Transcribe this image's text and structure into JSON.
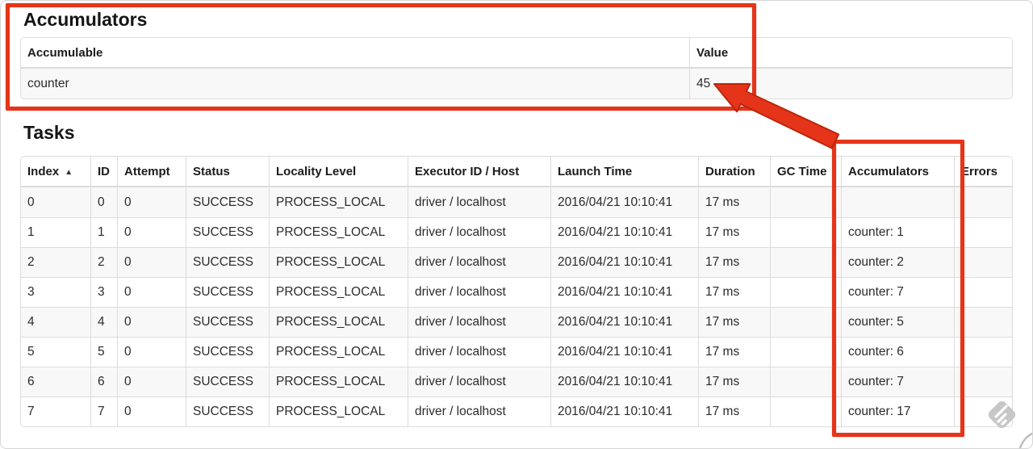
{
  "accumulators_section": {
    "title": "Accumulators",
    "table": {
      "header": {
        "accumulable": "Accumulable",
        "value": "Value"
      },
      "row": {
        "accumulable": "counter",
        "value": "45"
      }
    }
  },
  "tasks_section": {
    "title": "Tasks",
    "columns": {
      "index": "Index",
      "id": "ID",
      "attempt": "Attempt",
      "status": "Status",
      "locality": "Locality Level",
      "executor": "Executor ID / Host",
      "launch": "Launch Time",
      "duration": "Duration",
      "gc": "GC Time",
      "accumulators": "Accumulators",
      "errors": "Errors"
    },
    "sort_indicator": "▲",
    "rows": [
      {
        "index": "0",
        "id": "0",
        "attempt": "0",
        "status": "SUCCESS",
        "locality": "PROCESS_LOCAL",
        "executor": "driver / localhost",
        "launch": "2016/04/21 10:10:41",
        "duration": "17 ms",
        "gc": "",
        "accumulators": "",
        "errors": ""
      },
      {
        "index": "1",
        "id": "1",
        "attempt": "0",
        "status": "SUCCESS",
        "locality": "PROCESS_LOCAL",
        "executor": "driver / localhost",
        "launch": "2016/04/21 10:10:41",
        "duration": "17 ms",
        "gc": "",
        "accumulators": "counter: 1",
        "errors": ""
      },
      {
        "index": "2",
        "id": "2",
        "attempt": "0",
        "status": "SUCCESS",
        "locality": "PROCESS_LOCAL",
        "executor": "driver / localhost",
        "launch": "2016/04/21 10:10:41",
        "duration": "17 ms",
        "gc": "",
        "accumulators": "counter: 2",
        "errors": ""
      },
      {
        "index": "3",
        "id": "3",
        "attempt": "0",
        "status": "SUCCESS",
        "locality": "PROCESS_LOCAL",
        "executor": "driver / localhost",
        "launch": "2016/04/21 10:10:41",
        "duration": "17 ms",
        "gc": "",
        "accumulators": "counter: 7",
        "errors": ""
      },
      {
        "index": "4",
        "id": "4",
        "attempt": "0",
        "status": "SUCCESS",
        "locality": "PROCESS_LOCAL",
        "executor": "driver / localhost",
        "launch": "2016/04/21 10:10:41",
        "duration": "17 ms",
        "gc": "",
        "accumulators": "counter: 5",
        "errors": ""
      },
      {
        "index": "5",
        "id": "5",
        "attempt": "0",
        "status": "SUCCESS",
        "locality": "PROCESS_LOCAL",
        "executor": "driver / localhost",
        "launch": "2016/04/21 10:10:41",
        "duration": "17 ms",
        "gc": "",
        "accumulators": "counter: 6",
        "errors": ""
      },
      {
        "index": "6",
        "id": "6",
        "attempt": "0",
        "status": "SUCCESS",
        "locality": "PROCESS_LOCAL",
        "executor": "driver / localhost",
        "launch": "2016/04/21 10:10:41",
        "duration": "17 ms",
        "gc": "",
        "accumulators": "counter: 7",
        "errors": ""
      },
      {
        "index": "7",
        "id": "7",
        "attempt": "0",
        "status": "SUCCESS",
        "locality": "PROCESS_LOCAL",
        "executor": "driver / localhost",
        "launch": "2016/04/21 10:10:41",
        "duration": "17 ms",
        "gc": "",
        "accumulators": "counter: 17",
        "errors": ""
      }
    ]
  },
  "annotations": {
    "color": "#e6341a",
    "arrow_points_at": "45",
    "boxed_regions": [
      "accumulators-summary",
      "accumulators-task-column"
    ]
  },
  "watermark_icon": "skitch-watermark-icon"
}
